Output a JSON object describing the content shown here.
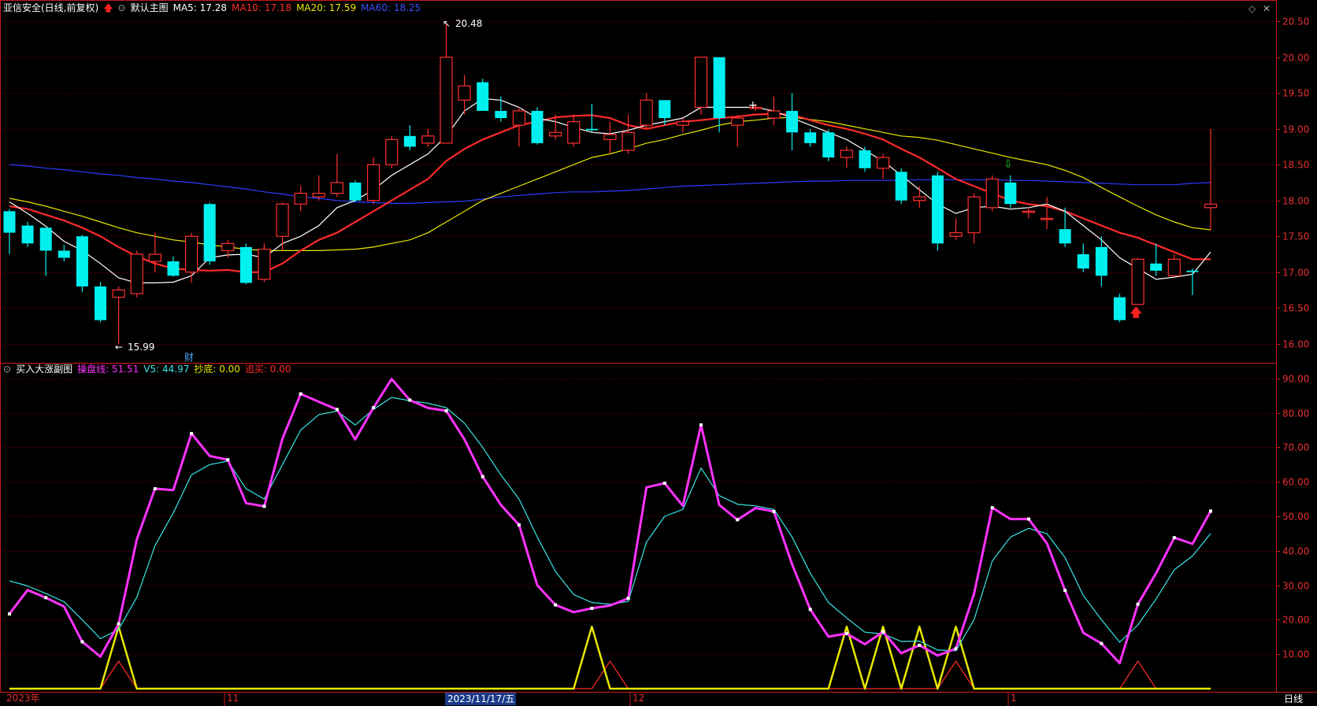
{
  "main_panel": {
    "stock_title": "亚信安全(日线,前复权)",
    "indicator_name": "默认主图",
    "ma": [
      {
        "label": "MA5: 17.28",
        "color": "#ffffff"
      },
      {
        "label": "MA10: 17.18",
        "color": "#ff2a2a"
      },
      {
        "label": "MA20: 17.59",
        "color": "#e8e800"
      },
      {
        "label": "MA60: 18.25",
        "color": "#2a3cff"
      }
    ],
    "high_label": "20.48",
    "low_label": "15.99",
    "fin_marker": "财"
  },
  "sub_panel": {
    "indicator_name": "买入大涨副图",
    "lines": [
      {
        "label": "操盘线: 51.51",
        "color": "#ff33ff"
      },
      {
        "label": "V5: 44.97",
        "color": "#39e6e6"
      },
      {
        "label": "抄底: 0.00",
        "color": "#e8e800"
      },
      {
        "label": "追买: 0.00",
        "color": "#ff2a2a"
      }
    ]
  },
  "bottom_bar": {
    "dates": [
      "2023年",
      "11",
      "2023/11/17/五",
      "12",
      "1"
    ],
    "period": "日线"
  },
  "colors": {
    "up": "#ff3030",
    "down": "#00f0f0",
    "grid": "#5a0000",
    "axis": "#cc1a1a",
    "price_text": "#e83030"
  },
  "chart_data": [
    {
      "type": "candlestick",
      "title": "亚信安全(日线,前复权)",
      "ylim": [
        15.8,
        20.6
      ],
      "yticks": [
        "20.50",
        "20.00",
        "19.50",
        "19.00",
        "18.50",
        "18.00",
        "17.50",
        "17.00",
        "16.50",
        "16.00"
      ],
      "candles": [
        [
          17.85,
          17.55,
          17.88,
          17.25
        ],
        [
          17.65,
          17.4,
          17.7,
          17.35
        ],
        [
          17.62,
          17.3,
          17.62,
          16.95
        ],
        [
          17.3,
          17.2,
          17.38,
          17.15
        ],
        [
          17.5,
          16.8,
          17.52,
          16.72
        ],
        [
          16.8,
          16.33,
          16.86,
          16.3
        ],
        [
          16.65,
          16.75,
          16.8,
          16.0
        ],
        [
          16.7,
          17.25,
          17.3,
          16.65
        ],
        [
          17.15,
          17.25,
          17.55,
          17.0
        ],
        [
          17.15,
          16.95,
          17.22,
          16.93
        ],
        [
          17.0,
          17.5,
          17.55,
          16.85
        ],
        [
          17.95,
          17.15,
          17.97,
          17.1
        ],
        [
          17.3,
          17.4,
          17.45,
          17.2
        ],
        [
          17.35,
          16.85,
          17.4,
          16.83
        ],
        [
          16.9,
          17.32,
          17.4,
          16.86
        ],
        [
          17.5,
          17.95,
          17.97,
          17.3
        ],
        [
          17.95,
          18.1,
          18.2,
          17.85
        ],
        [
          18.05,
          18.1,
          18.35,
          18.0
        ],
        [
          18.1,
          18.25,
          18.65,
          18.05
        ],
        [
          18.25,
          18.0,
          18.28,
          17.98
        ],
        [
          18.0,
          18.5,
          18.6,
          17.95
        ],
        [
          18.5,
          18.85,
          18.9,
          18.45
        ],
        [
          18.9,
          18.75,
          19.05,
          18.7
        ],
        [
          18.8,
          18.9,
          19.0,
          18.75
        ],
        [
          18.8,
          20.0,
          20.48,
          18.8
        ],
        [
          19.4,
          19.6,
          19.75,
          19.2
        ],
        [
          19.65,
          19.25,
          19.7,
          19.25
        ],
        [
          19.25,
          19.15,
          19.45,
          19.1
        ],
        [
          19.05,
          19.25,
          19.3,
          18.75
        ],
        [
          19.25,
          18.8,
          19.3,
          18.78
        ],
        [
          18.9,
          18.95,
          19.2,
          18.85
        ],
        [
          18.8,
          19.1,
          19.2,
          18.75
        ],
        [
          19.0,
          18.98,
          19.35,
          18.95
        ],
        [
          18.85,
          18.92,
          19.1,
          18.65
        ],
        [
          18.7,
          18.95,
          19.2,
          18.65
        ],
        [
          19.05,
          19.4,
          19.5,
          19.0
        ],
        [
          19.4,
          19.15,
          19.4,
          19.05
        ],
        [
          19.05,
          19.1,
          19.15,
          18.95
        ],
        [
          19.3,
          20.0,
          20.0,
          19.2
        ],
        [
          20.0,
          19.15,
          20.0,
          18.95
        ],
        [
          19.05,
          19.15,
          19.2,
          18.75
        ],
        [
          19.3,
          19.3,
          19.35,
          19.25
        ],
        [
          19.15,
          19.25,
          19.45,
          19.05
        ],
        [
          19.25,
          18.95,
          19.5,
          18.7
        ],
        [
          18.95,
          18.8,
          19.0,
          18.75
        ],
        [
          18.95,
          18.6,
          18.99,
          18.55
        ],
        [
          18.6,
          18.7,
          18.75,
          18.45
        ],
        [
          18.7,
          18.45,
          18.75,
          18.4
        ],
        [
          18.45,
          18.6,
          18.65,
          18.3
        ],
        [
          18.4,
          18.0,
          18.45,
          17.95
        ],
        [
          18.0,
          18.05,
          18.2,
          17.9
        ],
        [
          18.35,
          17.4,
          18.4,
          17.3
        ],
        [
          17.5,
          17.55,
          17.75,
          17.45
        ],
        [
          17.55,
          18.05,
          18.1,
          17.4
        ],
        [
          17.9,
          18.3,
          18.35,
          17.85
        ],
        [
          18.25,
          17.95,
          18.35,
          17.9
        ],
        [
          17.85,
          17.85,
          17.9,
          17.75
        ],
        [
          17.75,
          17.75,
          18.05,
          17.6
        ],
        [
          17.6,
          17.4,
          17.9,
          17.35
        ],
        [
          17.25,
          17.05,
          17.4,
          17.0
        ],
        [
          17.35,
          16.95,
          17.5,
          16.8
        ],
        [
          16.65,
          16.33,
          16.7,
          16.3
        ],
        [
          16.55,
          17.18,
          17.2,
          16.55
        ],
        [
          17.12,
          17.02,
          17.4,
          16.95
        ],
        [
          16.95,
          17.18,
          17.25,
          16.95
        ],
        [
          17.02,
          17.0,
          17.05,
          16.68
        ],
        [
          17.9,
          17.95,
          19.0,
          17.58
        ]
      ],
      "ma_series": [
        {
          "name": "MA5",
          "color": "#ffffff",
          "values": [
            17.98,
            17.82,
            17.64,
            17.43,
            17.3,
            17.12,
            16.92,
            16.85,
            16.85,
            16.86,
            16.95,
            17.2,
            17.24,
            17.25,
            17.2,
            17.4,
            17.5,
            17.65,
            17.9,
            18.0,
            18.15,
            18.35,
            18.5,
            18.65,
            18.9,
            19.25,
            19.42,
            19.4,
            19.3,
            19.15,
            19.1,
            19.02,
            18.95,
            18.93,
            18.98,
            19.05,
            19.1,
            19.15,
            19.3,
            19.3,
            19.3,
            19.3,
            19.25,
            19.15,
            19.05,
            18.95,
            18.85,
            18.7,
            18.55,
            18.35,
            18.15,
            17.95,
            17.82,
            17.9,
            17.92,
            17.88,
            17.9,
            17.95,
            17.85,
            17.65,
            17.45,
            17.2,
            17.05,
            16.9,
            16.93,
            16.97,
            17.28
          ]
        },
        {
          "name": "MA10",
          "color": "#ff2a2a",
          "values": [
            17.92,
            17.88,
            17.8,
            17.72,
            17.62,
            17.5,
            17.35,
            17.22,
            17.12,
            17.05,
            17.03,
            17.02,
            17.03,
            17.0,
            17.0,
            17.12,
            17.3,
            17.45,
            17.55,
            17.7,
            17.85,
            18.0,
            18.15,
            18.3,
            18.55,
            18.72,
            18.85,
            18.95,
            19.05,
            19.1,
            19.16,
            19.18,
            19.19,
            19.15,
            19.05,
            19.0,
            19.05,
            19.1,
            19.12,
            19.15,
            19.17,
            19.2,
            19.21,
            19.2,
            19.12,
            19.05,
            19.0,
            18.93,
            18.85,
            18.72,
            18.6,
            18.45,
            18.3,
            18.2,
            18.1,
            18.0,
            17.95,
            17.92,
            17.85,
            17.75,
            17.65,
            17.55,
            17.48,
            17.38,
            17.28,
            17.18,
            17.18
          ]
        },
        {
          "name": "MA20",
          "color": "#e8e800",
          "values": [
            18.03,
            17.98,
            17.92,
            17.85,
            17.78,
            17.7,
            17.62,
            17.55,
            17.5,
            17.45,
            17.42,
            17.38,
            17.35,
            17.32,
            17.3,
            17.3,
            17.3,
            17.3,
            17.31,
            17.32,
            17.35,
            17.4,
            17.45,
            17.55,
            17.7,
            17.85,
            18.0,
            18.1,
            18.2,
            18.3,
            18.4,
            18.5,
            18.6,
            18.65,
            18.72,
            18.8,
            18.85,
            18.92,
            18.98,
            19.05,
            19.1,
            19.12,
            19.15,
            19.16,
            19.13,
            19.1,
            19.05,
            19.0,
            18.95,
            18.9,
            18.88,
            18.84,
            18.78,
            18.72,
            18.66,
            18.6,
            18.55,
            18.5,
            18.42,
            18.32,
            18.18,
            18.05,
            17.92,
            17.8,
            17.7,
            17.62,
            17.59
          ]
        },
        {
          "name": "MA60",
          "color": "#2a3cff",
          "values": [
            18.5,
            18.48,
            18.45,
            18.43,
            18.4,
            18.37,
            18.35,
            18.32,
            18.3,
            18.27,
            18.25,
            18.22,
            18.19,
            18.16,
            18.12,
            18.09,
            18.05,
            18.03,
            18.0,
            17.98,
            17.97,
            17.96,
            17.96,
            17.97,
            17.98,
            17.99,
            18.02,
            18.05,
            18.07,
            18.09,
            18.11,
            18.12,
            18.12,
            18.13,
            18.14,
            18.16,
            18.18,
            18.2,
            18.21,
            18.22,
            18.23,
            18.24,
            18.25,
            18.26,
            18.27,
            18.27,
            18.28,
            18.28,
            18.28,
            18.28,
            18.29,
            18.29,
            18.29,
            18.29,
            18.29,
            18.28,
            18.28,
            18.27,
            18.26,
            18.25,
            18.24,
            18.23,
            18.22,
            18.22,
            18.22,
            18.24,
            18.25
          ]
        }
      ]
    },
    {
      "type": "line",
      "title": "买入大涨副图",
      "ylim": [
        0,
        92
      ],
      "yticks": [
        "90.00",
        "80.00",
        "70.00",
        "60.00",
        "50.00",
        "40.00",
        "30.00",
        "20.00",
        "10.00"
      ],
      "series": [
        {
          "name": "操盘线",
          "color": "#ff33ff",
          "values": [
            21.7,
            28.6,
            26.4,
            23.8,
            13.6,
            9.3,
            18.8,
            43.3,
            58,
            57.6,
            74,
            67.5,
            66.4,
            53.8,
            52.9,
            72.5,
            85.5,
            83.2,
            81,
            72.3,
            81.5,
            89.8,
            83.7,
            81.4,
            80.6,
            72.3,
            61.5,
            53.3,
            47.5,
            30,
            24.3,
            22.2,
            23.3,
            24.1,
            26.2,
            58.4,
            59.6,
            53,
            76.5,
            53.3,
            49,
            52.4,
            51.4,
            36.1,
            23,
            15.1,
            16,
            12.9,
            16.5,
            10.3,
            12.6,
            9.6,
            11.6,
            27.5,
            52.5,
            49.2,
            49.2,
            42.2,
            28.5,
            16.2,
            13.1,
            7.4,
            24.5,
            33.5,
            43.8,
            42,
            51.5
          ]
        },
        {
          "name": "V5",
          "color": "#39e6e6",
          "values": [
            31.3,
            29.8,
            27.6,
            25.2,
            20,
            14.5,
            17.2,
            26.5,
            41.5,
            51,
            62,
            65,
            66,
            58,
            55,
            65,
            75,
            79.5,
            80.5,
            76.5,
            81,
            84.5,
            83.5,
            82.8,
            81.5,
            77,
            70,
            62,
            55,
            44,
            34,
            27.3,
            25,
            24.5,
            25.3,
            42.5,
            50,
            52,
            64,
            56,
            53.5,
            53,
            52,
            44,
            33.5,
            25,
            20.5,
            16.4,
            15.9,
            13.7,
            13.8,
            11.2,
            11,
            20,
            37,
            44,
            46.5,
            45,
            38,
            27,
            20,
            13.5,
            18.5,
            26,
            34.5,
            38.5,
            45
          ]
        },
        {
          "name": "抄底",
          "color": "#e8e800",
          "values": [
            0,
            0,
            0,
            0,
            0,
            0,
            18,
            0,
            0,
            0,
            0,
            0,
            0,
            0,
            0,
            0,
            0,
            0,
            0,
            0,
            0,
            0,
            0,
            0,
            0,
            0,
            0,
            0,
            0,
            0,
            0,
            0,
            18,
            0,
            0,
            0,
            0,
            0,
            0,
            0,
            0,
            0,
            0,
            0,
            0,
            0,
            18,
            0,
            18,
            0,
            18,
            0,
            18,
            0,
            0,
            0,
            0,
            0,
            0,
            0,
            0,
            0,
            0,
            0,
            0,
            0,
            0
          ]
        },
        {
          "name": "追买",
          "color": "#ff2a2a",
          "values": [
            0,
            0,
            0,
            0,
            0,
            0,
            8,
            0,
            0,
            0,
            0,
            0,
            0,
            0,
            0,
            0,
            0,
            0,
            0,
            0,
            0,
            0,
            0,
            0,
            0,
            0,
            0,
            0,
            0,
            0,
            0,
            0,
            0,
            8,
            0,
            0,
            0,
            0,
            0,
            0,
            0,
            0,
            0,
            0,
            0,
            0,
            0,
            0,
            0,
            0,
            0,
            0,
            8,
            0,
            0,
            0,
            0,
            0,
            0,
            0,
            0,
            0,
            8,
            0,
            0,
            0,
            0
          ]
        }
      ]
    }
  ]
}
